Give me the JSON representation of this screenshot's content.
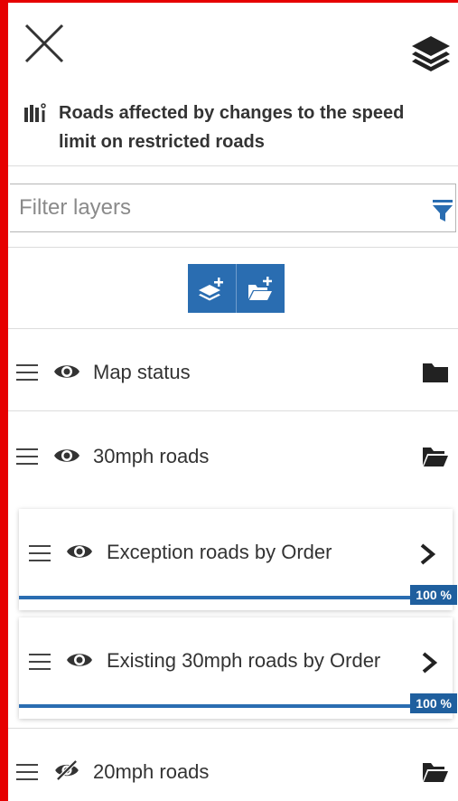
{
  "panel": {
    "title": "Roads affected by changes to the speed limit on restricted roads"
  },
  "icons": {
    "close": "close-icon",
    "layers": "layers-icon",
    "title": "map-info-icon",
    "filter": "filter-icon",
    "add_layer": "add-layer-icon",
    "add_group": "add-folder-icon"
  },
  "filter": {
    "placeholder": "Filter layers",
    "value": ""
  },
  "colors": {
    "accent": "#2a6db1",
    "frame": "#e60000"
  },
  "layers": [
    {
      "label": "Map status",
      "visible": true,
      "type": "group",
      "expanded": false
    },
    {
      "label": "30mph roads",
      "visible": true,
      "type": "group",
      "expanded": true,
      "children": [
        {
          "label": "Exception roads by Order",
          "visible": true,
          "progress_label": "100 %",
          "progress": 1.0
        },
        {
          "label": "Existing 30mph roads by Order",
          "visible": true,
          "progress_label": "100 %",
          "progress": 1.0
        }
      ]
    },
    {
      "label": "20mph roads",
      "visible": false,
      "type": "group",
      "expanded": true
    }
  ]
}
